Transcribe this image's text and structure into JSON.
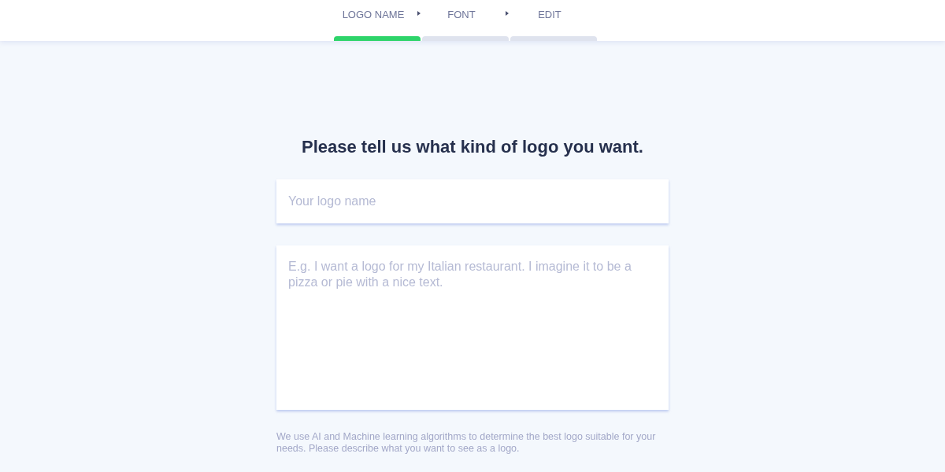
{
  "steps": [
    {
      "label": "LOGO NAME",
      "selected": true
    },
    {
      "label": "FONT",
      "selected": false
    },
    {
      "label": "EDIT",
      "selected": false
    }
  ],
  "heading": "Please tell us what kind of logo you want.",
  "name_field": {
    "placeholder": "Your logo name"
  },
  "description_field": {
    "placeholder": "E.g. I want a logo for my Italian restaurant. I imagine it to be a pizza or pie with a nice text."
  },
  "note": "We use AI and Machine learning algorithms to determine the best logo suitable for your needs. Please describe what you want to see as a logo."
}
